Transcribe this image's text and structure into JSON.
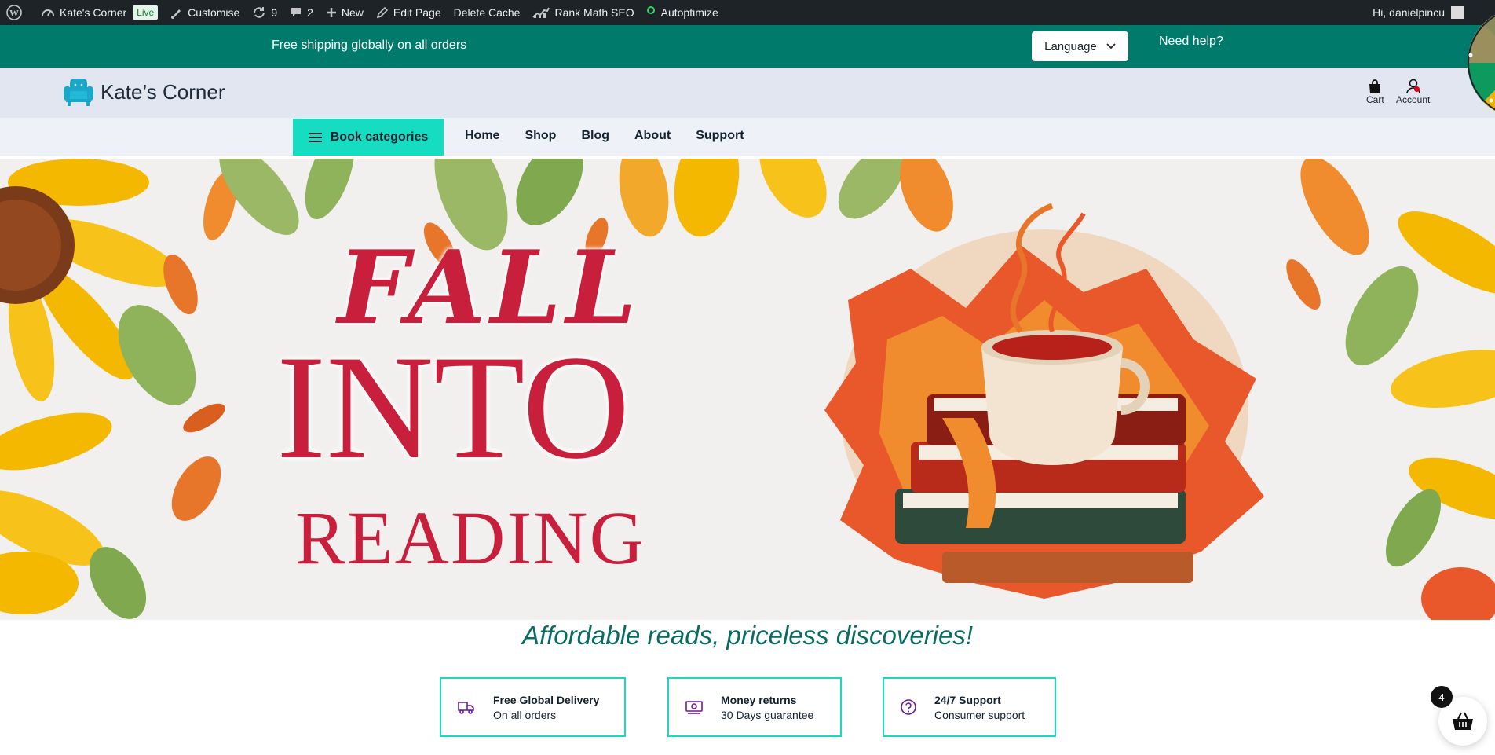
{
  "adminbar": {
    "site_name": "Kate's Corner",
    "live_badge": "Live",
    "customise": "Customise",
    "updates_count": "9",
    "comments_count": "2",
    "new_label": "New",
    "edit_page": "Edit Page",
    "delete_cache": "Delete Cache",
    "rank_math": "Rank Math SEO",
    "autoptimize": "Autoptimize",
    "greeting": "Hi, danielpincu"
  },
  "topbar": {
    "shipping": "Free shipping globally on all orders",
    "language": "Language",
    "help": "Need help?"
  },
  "header": {
    "logo_text": "Kate’s Corner",
    "cart_label": "Cart",
    "account_label": "Account"
  },
  "nav": {
    "categories_label": "Book categories",
    "links": [
      "Home",
      "Shop",
      "Blog",
      "About",
      "Support"
    ]
  },
  "hero": {
    "line1": "FALL",
    "line2": "INTO",
    "line3": "READING"
  },
  "tagline": "Affordable reads, priceless discoveries!",
  "features": [
    {
      "title": "Free Global Delivery",
      "subtitle": "On all orders",
      "icon": "truck-icon"
    },
    {
      "title": "Money returns",
      "subtitle": "30 Days guarantee",
      "icon": "money-icon"
    },
    {
      "title": "24/7 Support",
      "subtitle": "Consumer support",
      "icon": "question-icon"
    }
  ],
  "basket": {
    "count": "4"
  },
  "colors": {
    "admin_bar": "#1d2327",
    "topbar": "#007a6b",
    "accent": "#16dcc1",
    "hero_text": "#c8203c",
    "tagline": "#0a6b63",
    "feature_icon": "#6a1b9a"
  }
}
